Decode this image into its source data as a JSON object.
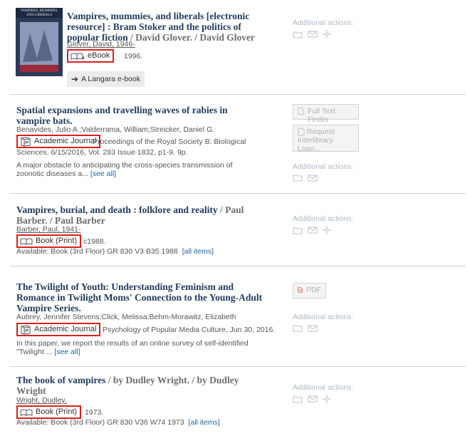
{
  "results": [
    {
      "title": "Vampires, mummies, and liberals [electronic resource] : Bram Stoker and the politics of popular fiction",
      "responsibility": " / David Glover. / David Glover",
      "author": "Glover, David, 1946-",
      "format": "eBook",
      "year": "1996.",
      "cover_text": "VAMPIRES, MUMMIES, AND LIBERALS",
      "extra_link": "A Langara e-book",
      "actions_label": "Additional actions:"
    },
    {
      "title": "Spatial expansions and travelling waves of rabies in vampire bats.",
      "author": "Benavides, Julio A.;Valderrama, William;Streicker, Daniel G.",
      "format": "Academic Journal",
      "pub_first": "Proceedings of the Royal Society B: Biological",
      "pub_rest": "Sciences. 6/15/2016, Vol. 283 Issue 1832, p1-9. 9p.",
      "abstract": "A major obstacle to anticipating the cross-species transmission of zoonotic diseases a...",
      "see_all": "[see all]",
      "button1": "Full Text Finder",
      "button2_line1": "Request",
      "button2_line2": "Interlibrary Loan...",
      "actions_label": "Additional actions:"
    },
    {
      "title": "Vampires, burial, and death : folklore and reality",
      "responsibility": " / Paul Barber. / Paul Barber",
      "author": "Barber, Paul, 1941-",
      "format": "Book (Print)",
      "year": "c1988.",
      "availability": "Available: Book (3rd Floor) GR 830 V3 B35 1988",
      "all_items": "[all items]",
      "actions_label": "Additional actions:"
    },
    {
      "title": "The Twilight of Youth: Understanding Feminism and Romance in Twilight Moms' Connection to the Young-Adult Vampire Series.",
      "author": "Aubrey, Jennifer Stevens;Click, Melissa;Behm-Morawitz, Elizabeth",
      "format": "Academic Journal",
      "pub_first": "Psychology of Popular Media Culture, Jun 30, 2016.",
      "abstract": "In this paper, we report the results of an online survey of self-identified \"Twilight ...",
      "see_all": "[see all]",
      "button1": "PDF",
      "actions_label": "Additional actions:"
    },
    {
      "title": "The book of vampires",
      "responsibility": " / by Dudley Wright. / by Dudley Wright",
      "author": "Wright, Dudley.",
      "format": "Book (Print)",
      "year": "1973.",
      "availability": "Available: Book (3rd Floor) GR 830 V36 W74 1973",
      "all_items": "[all items]",
      "actions_label": "Additional actions:"
    }
  ],
  "colors": {
    "highlight": "#d8201f",
    "title": "#1f3b5c",
    "link": "#2a6496",
    "muted": "#aeb8c4"
  }
}
